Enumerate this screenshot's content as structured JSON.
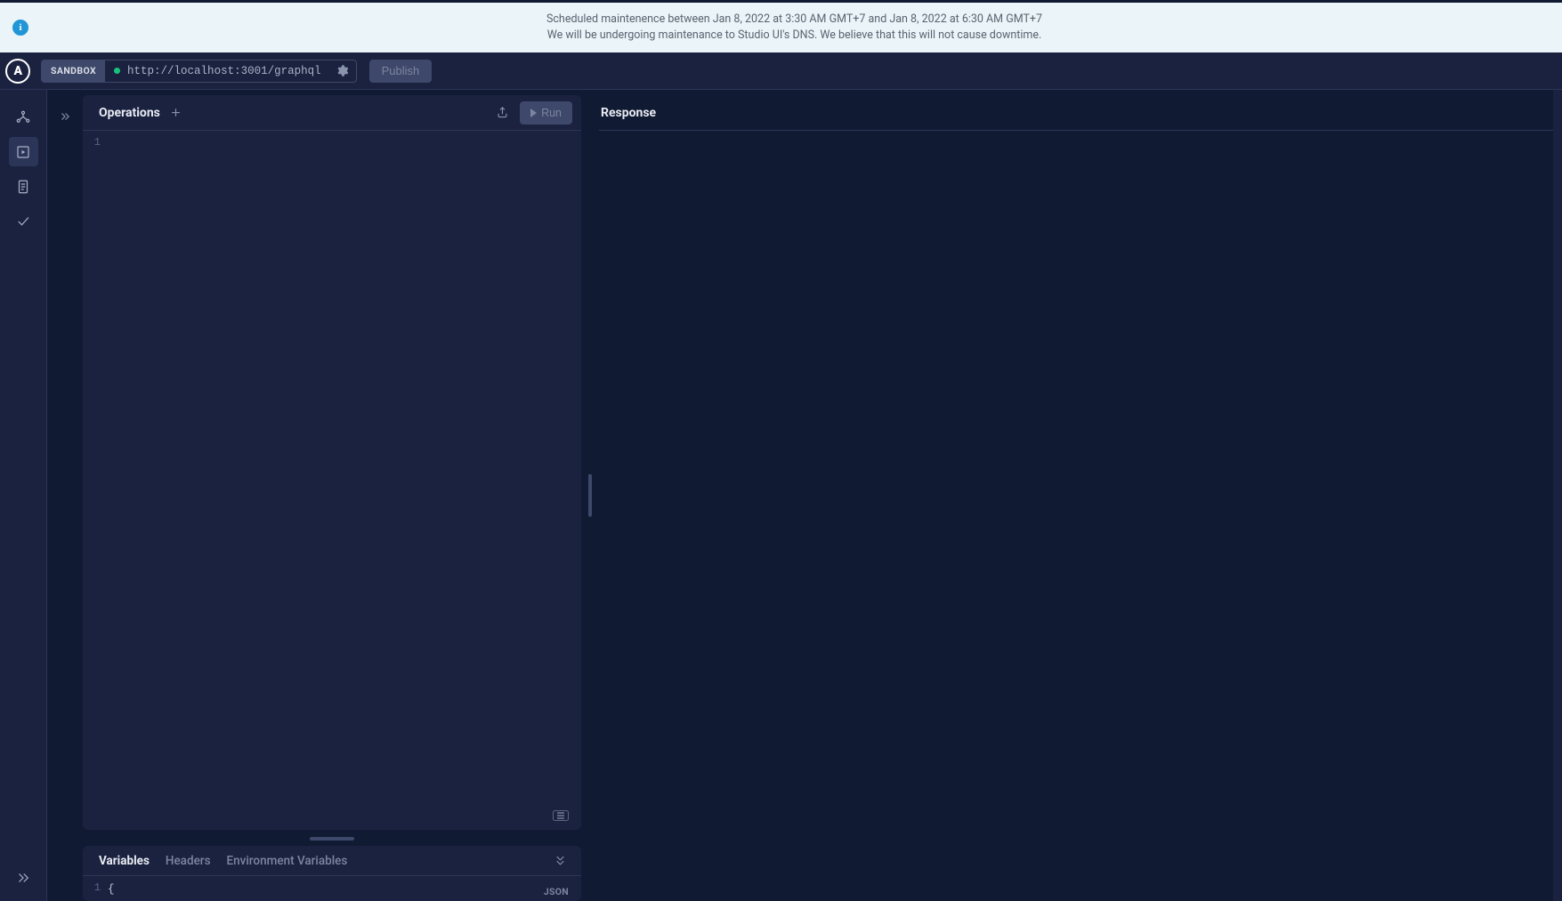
{
  "banner": {
    "line1": "Scheduled maintenence between Jan 8, 2022 at 3:30 AM GMT+7 and Jan 8, 2022 at 6:30 AM GMT+7",
    "line2": "We will be undergoing maintenance to Studio UI's DNS. We believe that this will not cause downtime."
  },
  "header": {
    "logo_letter": "A",
    "env_badge": "SANDBOX",
    "url": "http://localhost:3001/graphql",
    "publish_label": "Publish"
  },
  "sidebar": {
    "items": [
      {
        "name": "schema"
      },
      {
        "name": "explorer"
      },
      {
        "name": "docs"
      },
      {
        "name": "checks"
      }
    ]
  },
  "operations": {
    "title": "Operations",
    "line_number": "1",
    "run_label": "Run"
  },
  "variables": {
    "tabs": [
      "Variables",
      "Headers",
      "Environment Variables"
    ],
    "active_tab": 0,
    "line_number": "1",
    "content": "{",
    "format_label": "JSON"
  },
  "response": {
    "title": "Response"
  }
}
